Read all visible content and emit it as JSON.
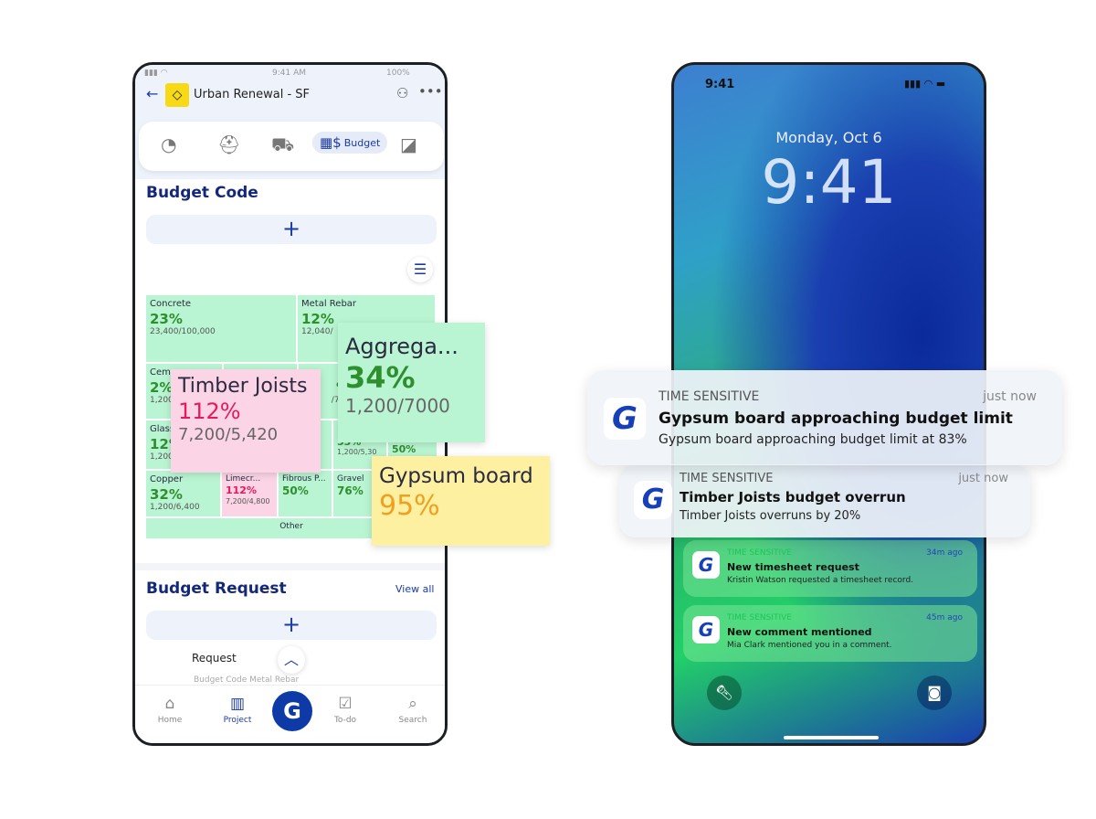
{
  "left_phone": {
    "status": {
      "time": "9:41 AM",
      "battery": "100%"
    },
    "header": {
      "title": "Urban Renewal - SF",
      "back_icon": "arrow-left-icon",
      "add_user_icon": "add-user-icon",
      "more_icon": "more-icon"
    },
    "tabs": [
      {
        "icon": "speedometer-icon"
      },
      {
        "icon": "hardhat-gear-icon"
      },
      {
        "icon": "mixer-truck-icon"
      },
      {
        "icon": "calculator-dollar-icon",
        "label": "Budget",
        "active": true
      },
      {
        "icon": "blueprint-icon"
      }
    ],
    "budget_code": {
      "title": "Budget Code",
      "add": "+"
    },
    "treemap": [
      {
        "name": "Concrete",
        "pct": "23%",
        "amount": "23,400/100,000"
      },
      {
        "name": "Metal Rebar",
        "pct": "12%",
        "amount": "12,040/"
      },
      {
        "name": "Cem",
        "pct": "2%",
        "amount": "1,200/"
      },
      {
        "name": "ks",
        "pct": "%",
        "amount": "/738"
      },
      {
        "name": "Glass",
        "pct": "12%",
        "amount": "1,200/"
      },
      {
        "name": "E",
        "pct": "53%",
        "amount": "1,200/5,30"
      },
      {
        "name": "",
        "pct": "50%",
        "amount": ""
      },
      {
        "name": "Copper",
        "pct": "32%",
        "amount": "1,200/6,400"
      },
      {
        "name": "Limecr...",
        "pct": "112%",
        "amount": "7,200/4,800",
        "over": true
      },
      {
        "name": "Fibrous P...",
        "pct": "50%",
        "amount": ""
      },
      {
        "name": "Gravel",
        "pct": "76%",
        "amount": ""
      },
      {
        "name": "Other"
      }
    ],
    "callouts": {
      "timber": {
        "name": "Timber Joists",
        "pct": "112%",
        "amount": "7,200/5,420"
      },
      "aggregate": {
        "name": "Aggrega...",
        "pct": "34%",
        "amount": "1,200/7000"
      },
      "gypsum": {
        "name": "Gypsum board",
        "pct": "95%"
      }
    },
    "budget_request": {
      "title": "Budget Request",
      "view_all": "View all",
      "add": "+",
      "request_label": "Request",
      "peek": "Budget Code  Metal Rebar"
    },
    "nav": [
      {
        "label": "Home",
        "icon": "home-icon"
      },
      {
        "label": "Project",
        "icon": "project-icon",
        "active": true
      },
      {
        "label": "To-do",
        "icon": "clipboard-icon"
      },
      {
        "label": "Search",
        "icon": "search-icon"
      }
    ],
    "fab": "G"
  },
  "right_phone": {
    "status_time": "9:41",
    "date": "Monday, Oct 6",
    "clock": "9:41",
    "notifications": [
      {
        "tag": "TIME SENSITIVE",
        "time": "just now",
        "title": "Gypsum board approaching budget limit",
        "body": "Gypsum board approaching budget limit at 83%"
      },
      {
        "tag": "TIME SENSITIVE",
        "time": "just now",
        "title": "Timber Joists budget overrun",
        "body": "Timber Joists overruns by 20%"
      },
      {
        "tag": "TIME SENSITIVE",
        "time": "34m ago",
        "title": "New timesheet request",
        "body": "Kristin Watson requested a timesheet record."
      },
      {
        "tag": "TIME SENSITIVE",
        "time": "45m ago",
        "title": "New comment mentioned",
        "body": "Mia Clark mentioned you in a comment."
      }
    ],
    "app_icon": "G"
  },
  "colors": {
    "accent": "#1b3aa6",
    "green": "#2f8f2f",
    "over": "#e6195b",
    "warn": "#f0a020",
    "cell": "#b9f5d2"
  }
}
